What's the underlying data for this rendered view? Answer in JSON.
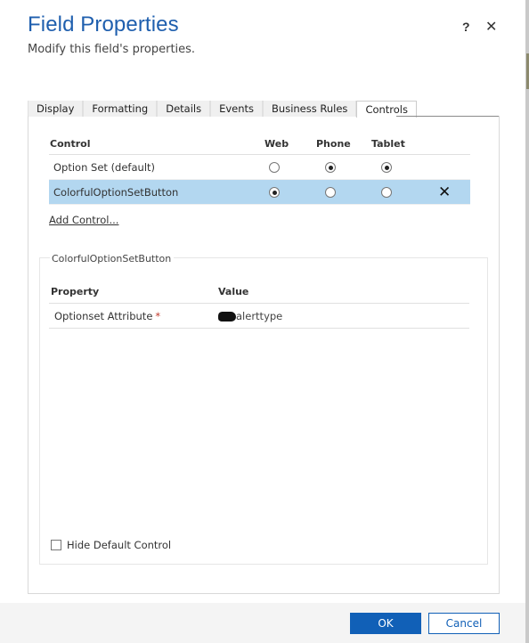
{
  "dialog": {
    "title": "Field Properties",
    "subtitle": "Modify this field's properties.",
    "help_icon": "?",
    "close_icon": "✕"
  },
  "tabs": [
    {
      "label": "Display",
      "active": false
    },
    {
      "label": "Formatting",
      "active": false
    },
    {
      "label": "Details",
      "active": false
    },
    {
      "label": "Events",
      "active": false
    },
    {
      "label": "Business Rules",
      "active": false
    },
    {
      "label": "Controls",
      "active": true
    }
  ],
  "controls_table": {
    "headers": {
      "control": "Control",
      "web": "Web",
      "phone": "Phone",
      "tablet": "Tablet"
    },
    "rows": [
      {
        "name": "Option Set (default)",
        "web": false,
        "phone": true,
        "tablet": true,
        "selected": false,
        "deletable": false
      },
      {
        "name": "ColorfulOptionSetButton",
        "web": true,
        "phone": false,
        "tablet": false,
        "selected": true,
        "deletable": true
      }
    ],
    "delete_icon": "✕",
    "add_control_label": "Add Control..."
  },
  "properties_section": {
    "legend": "ColorfulOptionSetButton",
    "headers": {
      "property": "Property",
      "value": "Value"
    },
    "rows": [
      {
        "property": "Optionset Attribute",
        "required_mark": "*",
        "value_visible": "alerttype",
        "value_prefix_redacted": true
      }
    ],
    "hide_default_control_label": "Hide Default Control",
    "hide_default_control_checked": false
  },
  "footer": {
    "ok_label": "OK",
    "cancel_label": "Cancel"
  },
  "colors": {
    "title_blue": "#1f5fae",
    "selected_row": "#b3d7f0",
    "primary_button": "#1160b7",
    "required": "#c0392b"
  }
}
